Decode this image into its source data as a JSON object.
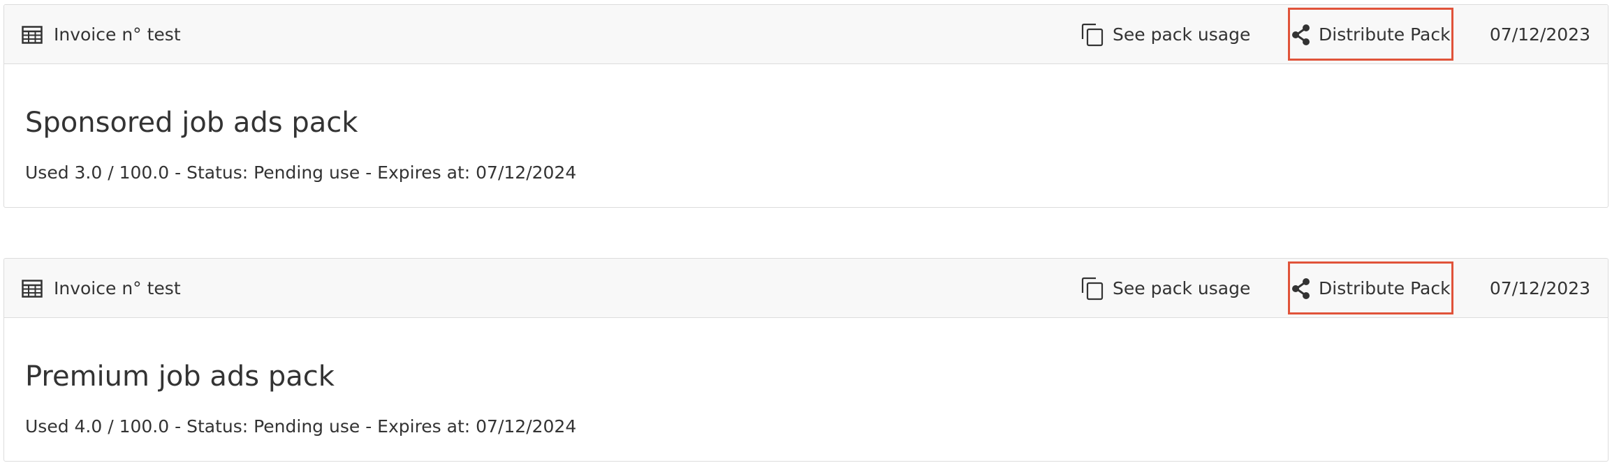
{
  "packs": [
    {
      "invoice_label": "Invoice n° test",
      "see_usage_label": "See pack usage",
      "distribute_label": "Distribute Pack",
      "date": "07/12/2023",
      "title": "Sponsored job ads pack",
      "meta": "Used 3.0 / 100.0 - Status: Pending use - Expires at: 07/12/2024"
    },
    {
      "invoice_label": "Invoice n° test",
      "see_usage_label": "See pack usage",
      "distribute_label": "Distribute Pack",
      "date": "07/12/2023",
      "title": "Premium job ads pack",
      "meta": "Used 4.0 / 100.0 - Status: Pending use - Expires at: 07/12/2024"
    }
  ],
  "colors": {
    "highlight": "#e0533a",
    "header_bg": "#f8f8f8",
    "border": "#dcdcdc",
    "text": "#333333"
  },
  "icons": {
    "invoice": "table-icon",
    "usage": "copy-icon",
    "distribute": "share-icon"
  }
}
